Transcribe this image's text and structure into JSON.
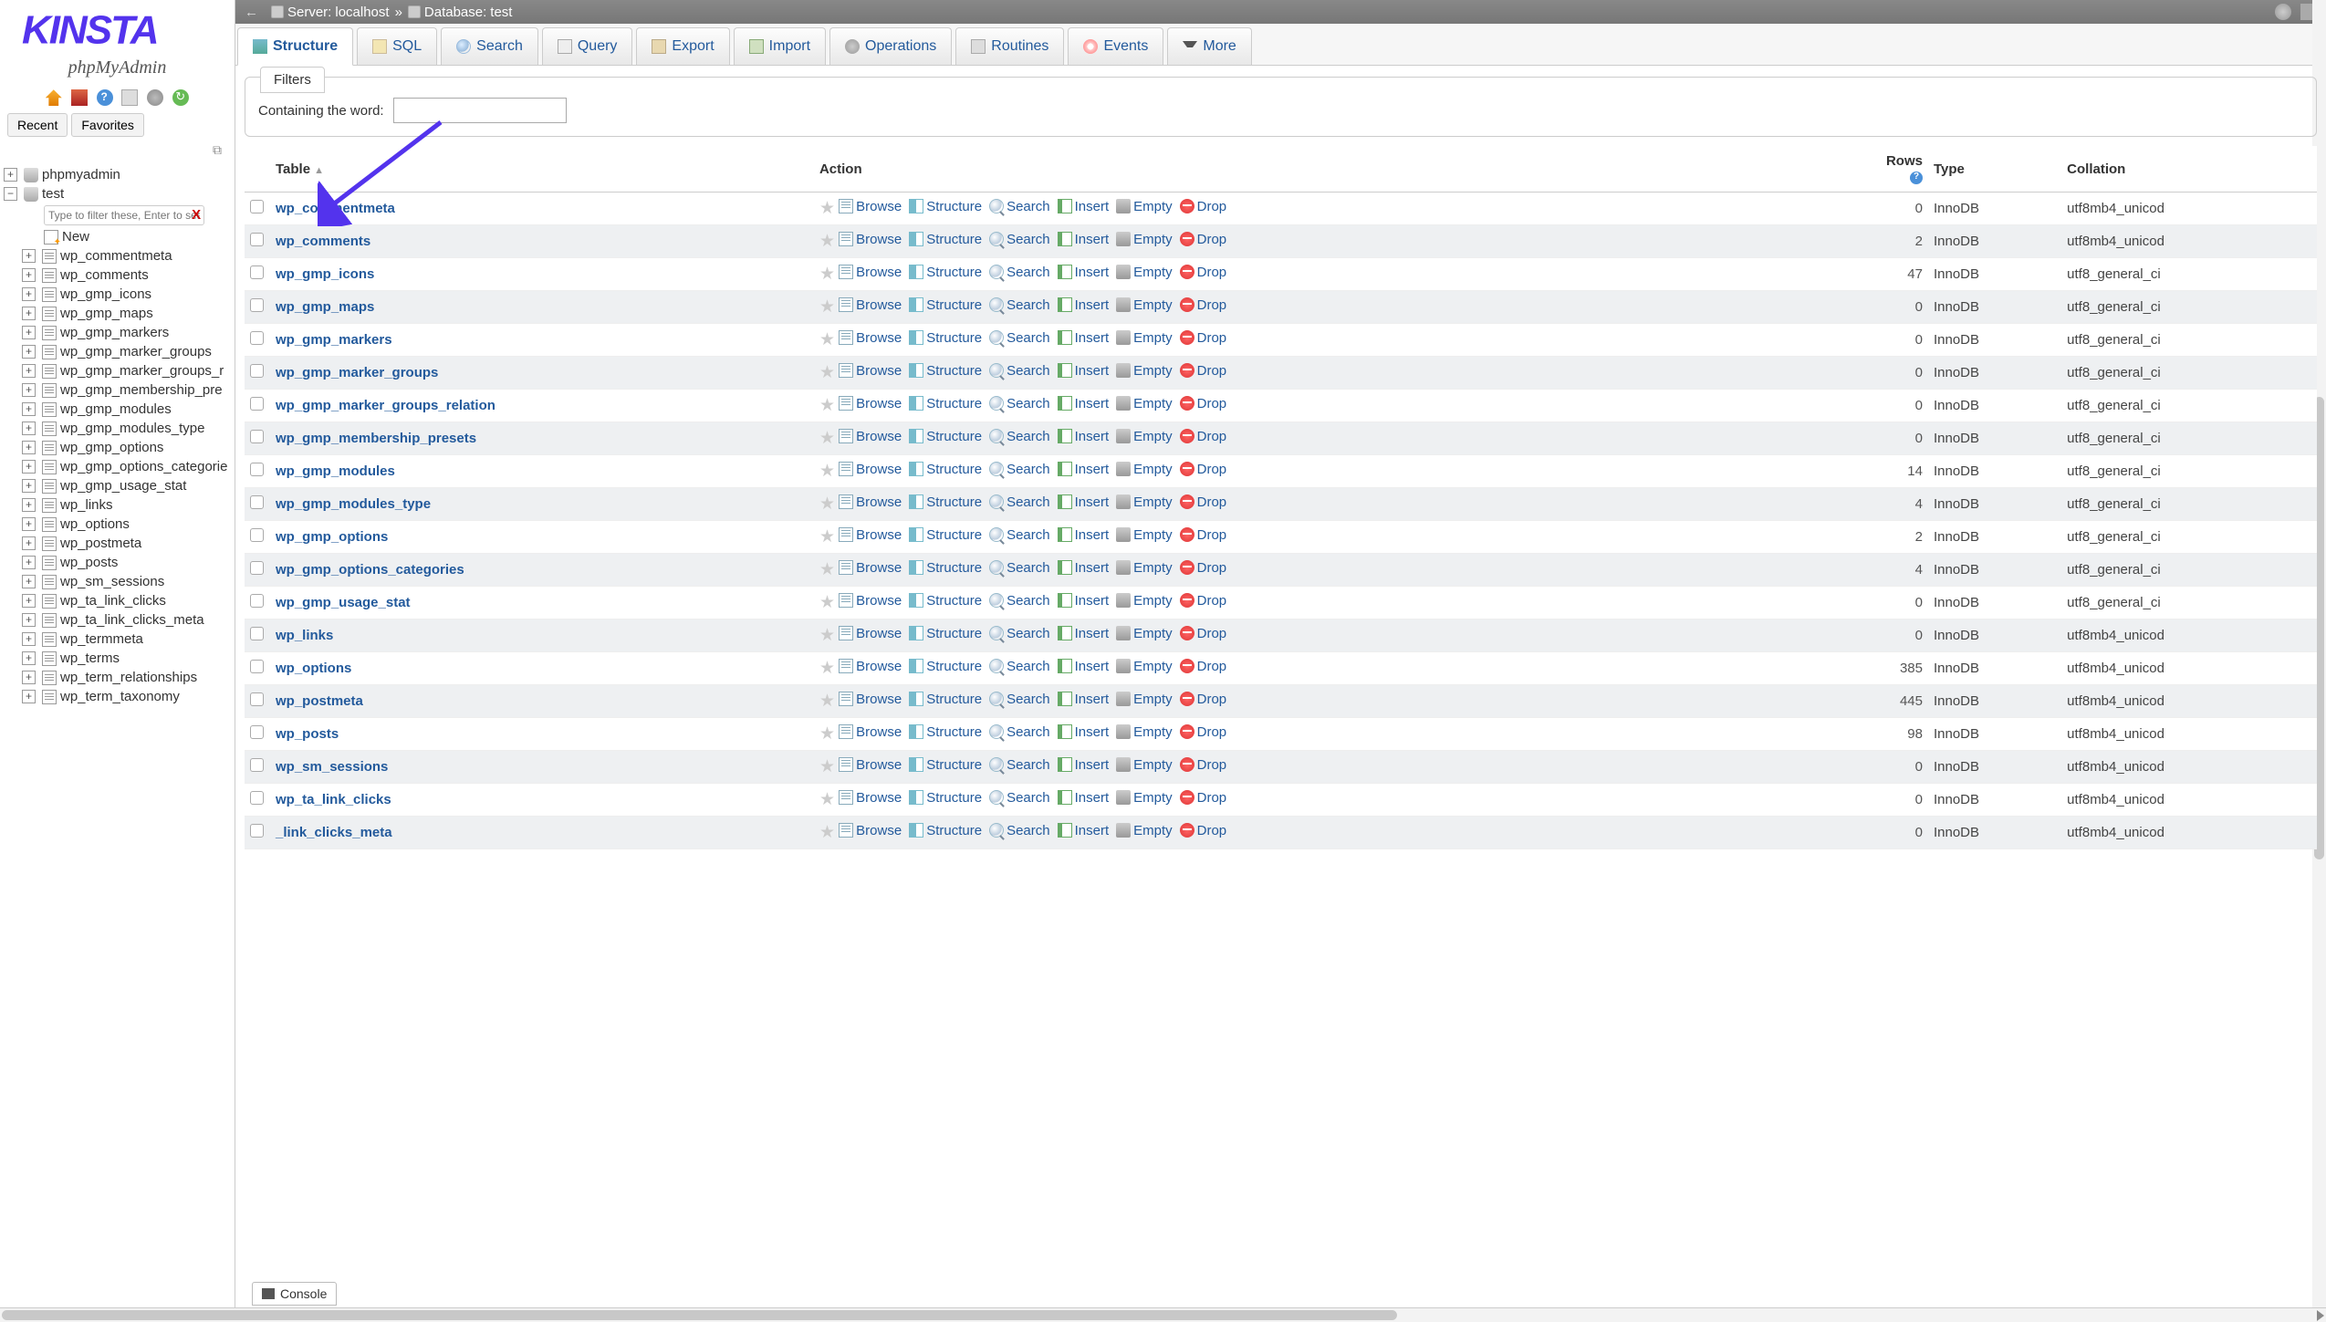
{
  "logo": {
    "subtitle": "phpMyAdmin"
  },
  "sidetabs": {
    "recent": "Recent",
    "favorites": "Favorites"
  },
  "tree": {
    "root": "phpmyadmin",
    "db": "test",
    "filter_placeholder": "Type to filter these, Enter to search",
    "new": "New",
    "tables": [
      "wp_commentmeta",
      "wp_comments",
      "wp_gmp_icons",
      "wp_gmp_maps",
      "wp_gmp_markers",
      "wp_gmp_marker_groups",
      "wp_gmp_marker_groups_r",
      "wp_gmp_membership_pre",
      "wp_gmp_modules",
      "wp_gmp_modules_type",
      "wp_gmp_options",
      "wp_gmp_options_categorie",
      "wp_gmp_usage_stat",
      "wp_links",
      "wp_options",
      "wp_postmeta",
      "wp_posts",
      "wp_sm_sessions",
      "wp_ta_link_clicks",
      "wp_ta_link_clicks_meta",
      "wp_termmeta",
      "wp_terms",
      "wp_term_relationships",
      "wp_term_taxonomy"
    ]
  },
  "breadcrumb": {
    "server_label": "Server:",
    "server": "localhost",
    "db_label": "Database:",
    "db": "test"
  },
  "tabs": {
    "structure": "Structure",
    "sql": "SQL",
    "search": "Search",
    "query": "Query",
    "export": "Export",
    "import": "Import",
    "operations": "Operations",
    "routines": "Routines",
    "events": "Events",
    "more": "More"
  },
  "filters": {
    "title": "Filters",
    "label": "Containing the word:"
  },
  "headers": {
    "table": "Table",
    "action": "Action",
    "rows": "Rows",
    "type": "Type",
    "collation": "Collation"
  },
  "actions": {
    "browse": "Browse",
    "structure": "Structure",
    "search": "Search",
    "insert": "Insert",
    "empty": "Empty",
    "drop": "Drop"
  },
  "rows": [
    {
      "name": "wp_commentmeta",
      "rows": "0",
      "type": "InnoDB",
      "coll": "utf8mb4_unicod"
    },
    {
      "name": "wp_comments",
      "rows": "2",
      "type": "InnoDB",
      "coll": "utf8mb4_unicod"
    },
    {
      "name": "wp_gmp_icons",
      "rows": "47",
      "type": "InnoDB",
      "coll": "utf8_general_ci"
    },
    {
      "name": "wp_gmp_maps",
      "rows": "0",
      "type": "InnoDB",
      "coll": "utf8_general_ci"
    },
    {
      "name": "wp_gmp_markers",
      "rows": "0",
      "type": "InnoDB",
      "coll": "utf8_general_ci"
    },
    {
      "name": "wp_gmp_marker_groups",
      "rows": "0",
      "type": "InnoDB",
      "coll": "utf8_general_ci"
    },
    {
      "name": "wp_gmp_marker_groups_relation",
      "rows": "0",
      "type": "InnoDB",
      "coll": "utf8_general_ci"
    },
    {
      "name": "wp_gmp_membership_presets",
      "rows": "0",
      "type": "InnoDB",
      "coll": "utf8_general_ci"
    },
    {
      "name": "wp_gmp_modules",
      "rows": "14",
      "type": "InnoDB",
      "coll": "utf8_general_ci"
    },
    {
      "name": "wp_gmp_modules_type",
      "rows": "4",
      "type": "InnoDB",
      "coll": "utf8_general_ci"
    },
    {
      "name": "wp_gmp_options",
      "rows": "2",
      "type": "InnoDB",
      "coll": "utf8_general_ci"
    },
    {
      "name": "wp_gmp_options_categories",
      "rows": "4",
      "type": "InnoDB",
      "coll": "utf8_general_ci"
    },
    {
      "name": "wp_gmp_usage_stat",
      "rows": "0",
      "type": "InnoDB",
      "coll": "utf8_general_ci"
    },
    {
      "name": "wp_links",
      "rows": "0",
      "type": "InnoDB",
      "coll": "utf8mb4_unicod"
    },
    {
      "name": "wp_options",
      "rows": "385",
      "type": "InnoDB",
      "coll": "utf8mb4_unicod"
    },
    {
      "name": "wp_postmeta",
      "rows": "445",
      "type": "InnoDB",
      "coll": "utf8mb4_unicod"
    },
    {
      "name": "wp_posts",
      "rows": "98",
      "type": "InnoDB",
      "coll": "utf8mb4_unicod"
    },
    {
      "name": "wp_sm_sessions",
      "rows": "0",
      "type": "InnoDB",
      "coll": "utf8mb4_unicod"
    },
    {
      "name": "wp_ta_link_clicks",
      "rows": "0",
      "type": "InnoDB",
      "coll": "utf8mb4_unicod"
    },
    {
      "name": "_link_clicks_meta",
      "rows": "0",
      "type": "InnoDB",
      "coll": "utf8mb4_unicod"
    }
  ],
  "console": "Console"
}
